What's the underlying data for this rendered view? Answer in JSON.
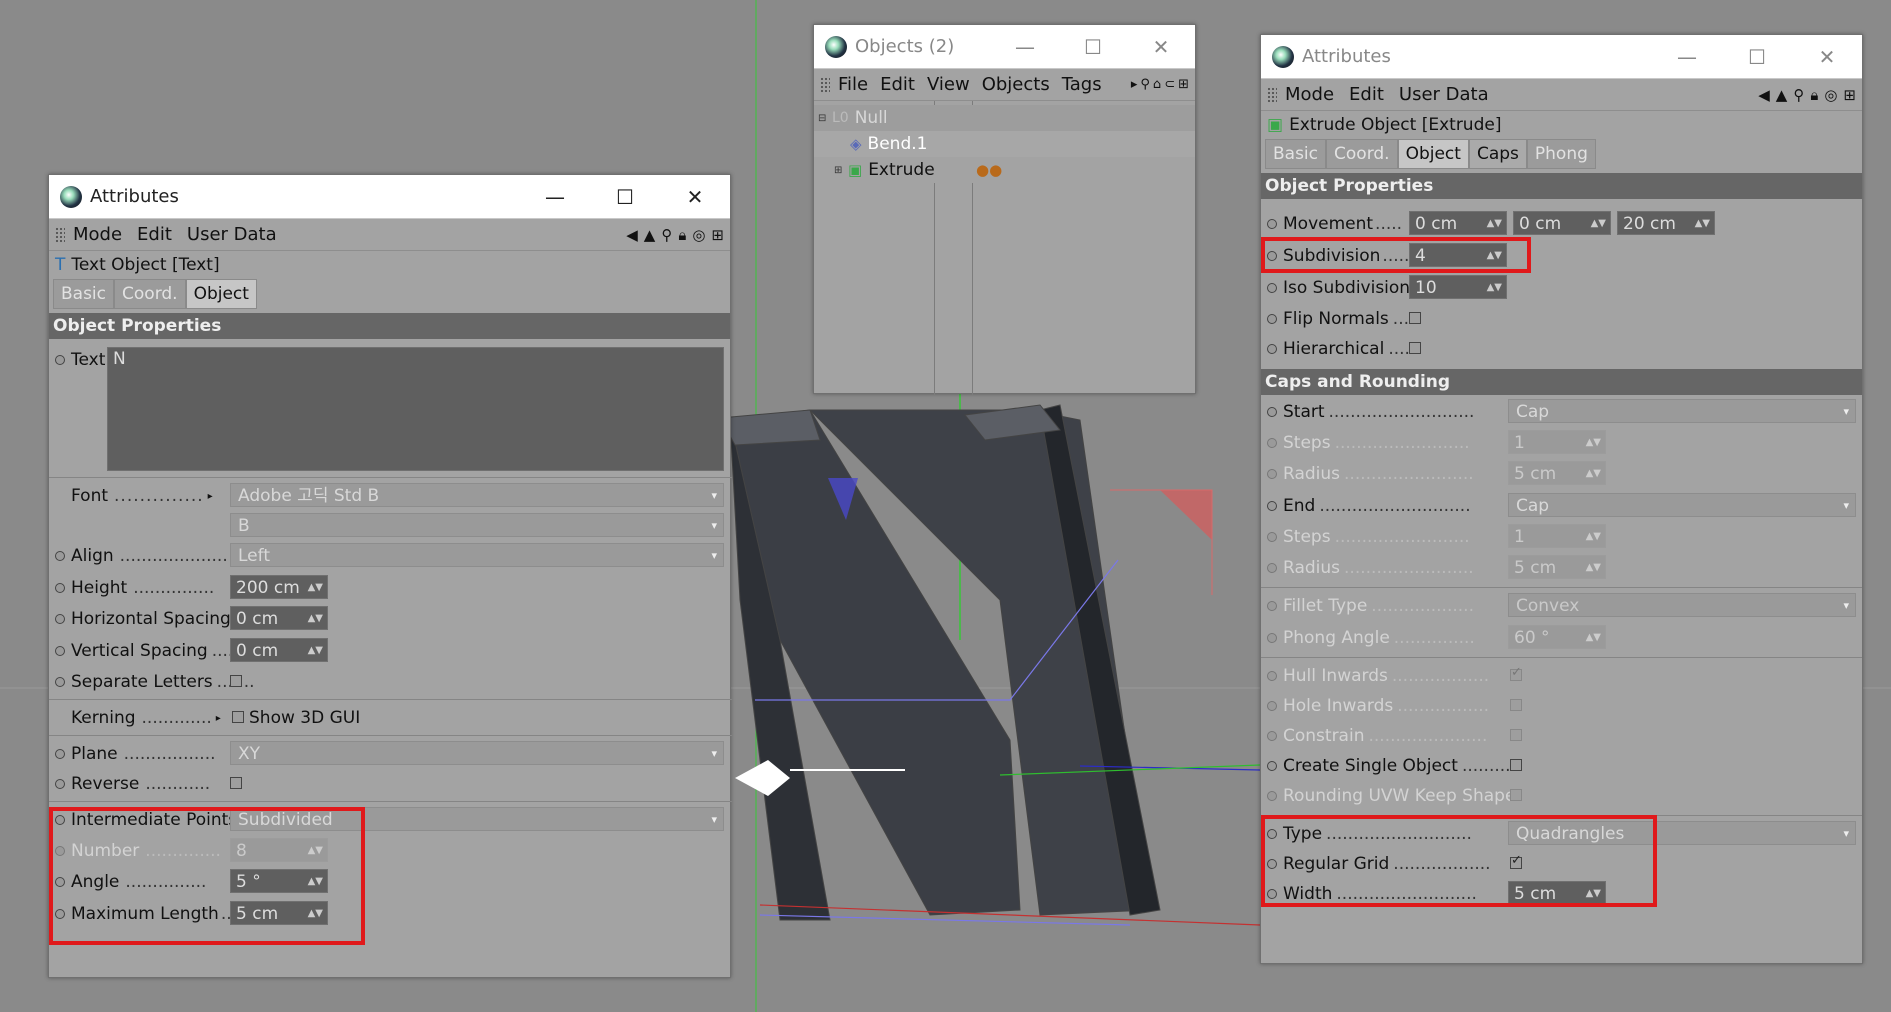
{
  "left_panel": {
    "title": "Attributes",
    "menus": [
      "Mode",
      "Edit",
      "User Data"
    ],
    "object_header": "Text Object [Text]",
    "tabs": [
      "Basic",
      "Coord.",
      "Object"
    ],
    "section": "Object Properties",
    "text_label": "Text",
    "text_value": "N",
    "font_label": "Font",
    "font_value": "Adobe 고딕 Std B",
    "font_style": "B",
    "align_label": "Align",
    "align_value": "Left",
    "height_label": "Height",
    "height_value": "200 cm",
    "hspacing_label": "Horizontal Spacing",
    "hspacing_value": "0 cm",
    "vspacing_label": "Vertical Spacing",
    "vspacing_value": "0 cm",
    "separate_label": "Separate Letters",
    "kerning_label": "Kerning",
    "show3d_label": "Show 3D GUI",
    "plane_label": "Plane",
    "plane_value": "XY",
    "reverse_label": "Reverse",
    "interp_label": "Intermediate Points",
    "interp_value": "Subdivided",
    "number_label": "Number",
    "number_value": "8",
    "angle_label": "Angle",
    "angle_value": "5 °",
    "maxlen_label": "Maximum Length",
    "maxlen_value": "5 cm"
  },
  "objects_panel": {
    "title": "Objects (2)",
    "menus": [
      "File",
      "Edit",
      "View",
      "Objects",
      "Tags"
    ],
    "items": [
      {
        "name": "Null"
      },
      {
        "name": "Bend.1"
      },
      {
        "name": "Extrude"
      }
    ]
  },
  "right_panel": {
    "title": "Attributes",
    "menus": [
      "Mode",
      "Edit",
      "User Data"
    ],
    "object_header": "Extrude Object [Extrude]",
    "tabs": [
      "Basic",
      "Coord.",
      "Object",
      "Caps",
      "Phong"
    ],
    "section1": "Object Properties",
    "movement_label": "Movement",
    "movement_x": "0 cm",
    "movement_y": "0 cm",
    "movement_z": "20 cm",
    "subdivision_label": "Subdivision",
    "subdivision_value": "4",
    "iso_label": "Iso Subdivision",
    "iso_value": "10",
    "flip_label": "Flip Normals",
    "hier_label": "Hierarchical",
    "section2": "Caps and Rounding",
    "start_label": "Start",
    "start_value": "Cap",
    "steps1_label": "Steps",
    "steps1_value": "1",
    "radius1_label": "Radius",
    "radius1_value": "5 cm",
    "end_label": "End",
    "end_value": "Cap",
    "steps2_label": "Steps",
    "steps2_value": "1",
    "radius2_label": "Radius",
    "radius2_value": "5 cm",
    "fillet_label": "Fillet Type",
    "fillet_value": "Convex",
    "phong_label": "Phong Angle",
    "phong_value": "60 °",
    "hull_label": "Hull Inwards",
    "hole_label": "Hole Inwards",
    "constrain_label": "Constrain",
    "single_label": "Create Single Object",
    "uvw_label": "Rounding UVW Keep Shape",
    "type_label": "Type",
    "type_value": "Quadrangles",
    "grid_label": "Regular Grid",
    "width_label": "Width",
    "width_value": "5 cm"
  },
  "colors": {
    "highlight": "#e0191b",
    "field_dark": "#5f5f5f",
    "panel": "#a3a3a3",
    "section": "#666666"
  }
}
